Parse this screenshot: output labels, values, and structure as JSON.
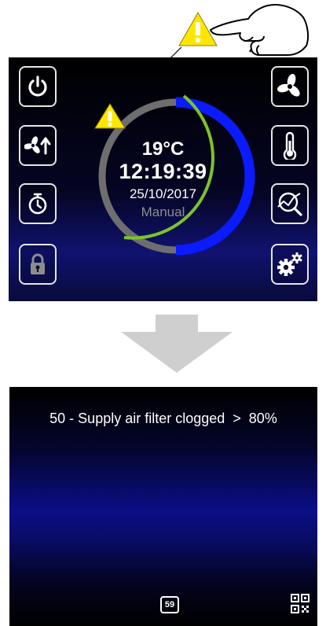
{
  "main_screen": {
    "temperature": "19°C",
    "time": "12:19:39",
    "date": "25/10/2017",
    "mode": "Manual",
    "left_buttons": [
      "power-icon",
      "fan-speed-up-icon",
      "timer-icon",
      "lock-icon"
    ],
    "right_buttons": [
      "fan-icon",
      "thermometer-icon",
      "chart-analysis-icon",
      "gears-icon"
    ]
  },
  "alarm_screen": {
    "message": "50 - Supply air filter clogged  >  80%",
    "alarm_count": "59"
  },
  "colors": {
    "ring_blue": "#0a1cff",
    "ring_green": "#7cc42a",
    "ring_gray": "#6e6e6e",
    "warning_yellow": "#ffe600",
    "arrow_gray": "#cfcfcf"
  }
}
